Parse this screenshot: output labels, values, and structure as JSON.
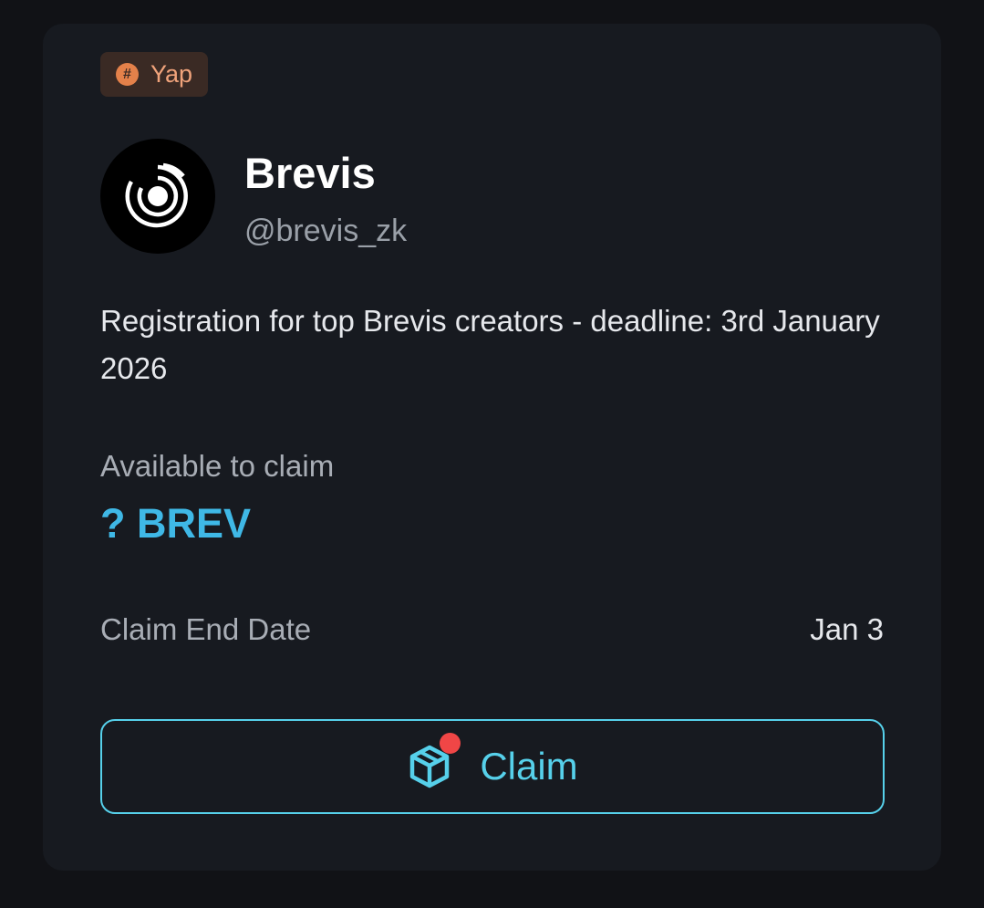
{
  "tag": {
    "label": "Yap",
    "icon": "hash-icon",
    "color": "#e4814a"
  },
  "profile": {
    "name": "Brevis",
    "handle": "@brevis_zk",
    "avatar_icon": "brevis-logo-icon"
  },
  "description": "Registration for top Brevis creators - deadline: 3rd January 2026",
  "claimable": {
    "label": "Available to claim",
    "value": "? BREV",
    "accent": "#3fb8e6"
  },
  "claim_end": {
    "label": "Claim End Date",
    "value": "Jan 3"
  },
  "claim_button": {
    "label": "Claim",
    "icon": "package-box-icon",
    "has_notification": true,
    "accent": "#56d0ea"
  }
}
